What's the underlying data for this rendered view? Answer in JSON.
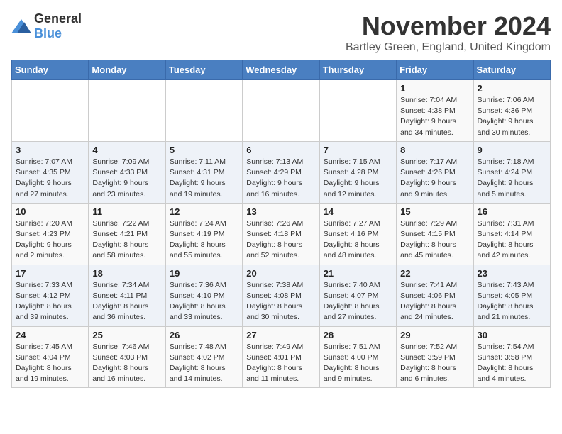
{
  "logo": {
    "general": "General",
    "blue": "Blue"
  },
  "title": "November 2024",
  "location": "Bartley Green, England, United Kingdom",
  "headers": [
    "Sunday",
    "Monday",
    "Tuesday",
    "Wednesday",
    "Thursday",
    "Friday",
    "Saturday"
  ],
  "weeks": [
    [
      {
        "day": "",
        "info": ""
      },
      {
        "day": "",
        "info": ""
      },
      {
        "day": "",
        "info": ""
      },
      {
        "day": "",
        "info": ""
      },
      {
        "day": "",
        "info": ""
      },
      {
        "day": "1",
        "info": "Sunrise: 7:04 AM\nSunset: 4:38 PM\nDaylight: 9 hours\nand 34 minutes."
      },
      {
        "day": "2",
        "info": "Sunrise: 7:06 AM\nSunset: 4:36 PM\nDaylight: 9 hours\nand 30 minutes."
      }
    ],
    [
      {
        "day": "3",
        "info": "Sunrise: 7:07 AM\nSunset: 4:35 PM\nDaylight: 9 hours\nand 27 minutes."
      },
      {
        "day": "4",
        "info": "Sunrise: 7:09 AM\nSunset: 4:33 PM\nDaylight: 9 hours\nand 23 minutes."
      },
      {
        "day": "5",
        "info": "Sunrise: 7:11 AM\nSunset: 4:31 PM\nDaylight: 9 hours\nand 19 minutes."
      },
      {
        "day": "6",
        "info": "Sunrise: 7:13 AM\nSunset: 4:29 PM\nDaylight: 9 hours\nand 16 minutes."
      },
      {
        "day": "7",
        "info": "Sunrise: 7:15 AM\nSunset: 4:28 PM\nDaylight: 9 hours\nand 12 minutes."
      },
      {
        "day": "8",
        "info": "Sunrise: 7:17 AM\nSunset: 4:26 PM\nDaylight: 9 hours\nand 9 minutes."
      },
      {
        "day": "9",
        "info": "Sunrise: 7:18 AM\nSunset: 4:24 PM\nDaylight: 9 hours\nand 5 minutes."
      }
    ],
    [
      {
        "day": "10",
        "info": "Sunrise: 7:20 AM\nSunset: 4:23 PM\nDaylight: 9 hours\nand 2 minutes."
      },
      {
        "day": "11",
        "info": "Sunrise: 7:22 AM\nSunset: 4:21 PM\nDaylight: 8 hours\nand 58 minutes."
      },
      {
        "day": "12",
        "info": "Sunrise: 7:24 AM\nSunset: 4:19 PM\nDaylight: 8 hours\nand 55 minutes."
      },
      {
        "day": "13",
        "info": "Sunrise: 7:26 AM\nSunset: 4:18 PM\nDaylight: 8 hours\nand 52 minutes."
      },
      {
        "day": "14",
        "info": "Sunrise: 7:27 AM\nSunset: 4:16 PM\nDaylight: 8 hours\nand 48 minutes."
      },
      {
        "day": "15",
        "info": "Sunrise: 7:29 AM\nSunset: 4:15 PM\nDaylight: 8 hours\nand 45 minutes."
      },
      {
        "day": "16",
        "info": "Sunrise: 7:31 AM\nSunset: 4:14 PM\nDaylight: 8 hours\nand 42 minutes."
      }
    ],
    [
      {
        "day": "17",
        "info": "Sunrise: 7:33 AM\nSunset: 4:12 PM\nDaylight: 8 hours\nand 39 minutes."
      },
      {
        "day": "18",
        "info": "Sunrise: 7:34 AM\nSunset: 4:11 PM\nDaylight: 8 hours\nand 36 minutes."
      },
      {
        "day": "19",
        "info": "Sunrise: 7:36 AM\nSunset: 4:10 PM\nDaylight: 8 hours\nand 33 minutes."
      },
      {
        "day": "20",
        "info": "Sunrise: 7:38 AM\nSunset: 4:08 PM\nDaylight: 8 hours\nand 30 minutes."
      },
      {
        "day": "21",
        "info": "Sunrise: 7:40 AM\nSunset: 4:07 PM\nDaylight: 8 hours\nand 27 minutes."
      },
      {
        "day": "22",
        "info": "Sunrise: 7:41 AM\nSunset: 4:06 PM\nDaylight: 8 hours\nand 24 minutes."
      },
      {
        "day": "23",
        "info": "Sunrise: 7:43 AM\nSunset: 4:05 PM\nDaylight: 8 hours\nand 21 minutes."
      }
    ],
    [
      {
        "day": "24",
        "info": "Sunrise: 7:45 AM\nSunset: 4:04 PM\nDaylight: 8 hours\nand 19 minutes."
      },
      {
        "day": "25",
        "info": "Sunrise: 7:46 AM\nSunset: 4:03 PM\nDaylight: 8 hours\nand 16 minutes."
      },
      {
        "day": "26",
        "info": "Sunrise: 7:48 AM\nSunset: 4:02 PM\nDaylight: 8 hours\nand 14 minutes."
      },
      {
        "day": "27",
        "info": "Sunrise: 7:49 AM\nSunset: 4:01 PM\nDaylight: 8 hours\nand 11 minutes."
      },
      {
        "day": "28",
        "info": "Sunrise: 7:51 AM\nSunset: 4:00 PM\nDaylight: 8 hours\nand 9 minutes."
      },
      {
        "day": "29",
        "info": "Sunrise: 7:52 AM\nSunset: 3:59 PM\nDaylight: 8 hours\nand 6 minutes."
      },
      {
        "day": "30",
        "info": "Sunrise: 7:54 AM\nSunset: 3:58 PM\nDaylight: 8 hours\nand 4 minutes."
      }
    ]
  ]
}
